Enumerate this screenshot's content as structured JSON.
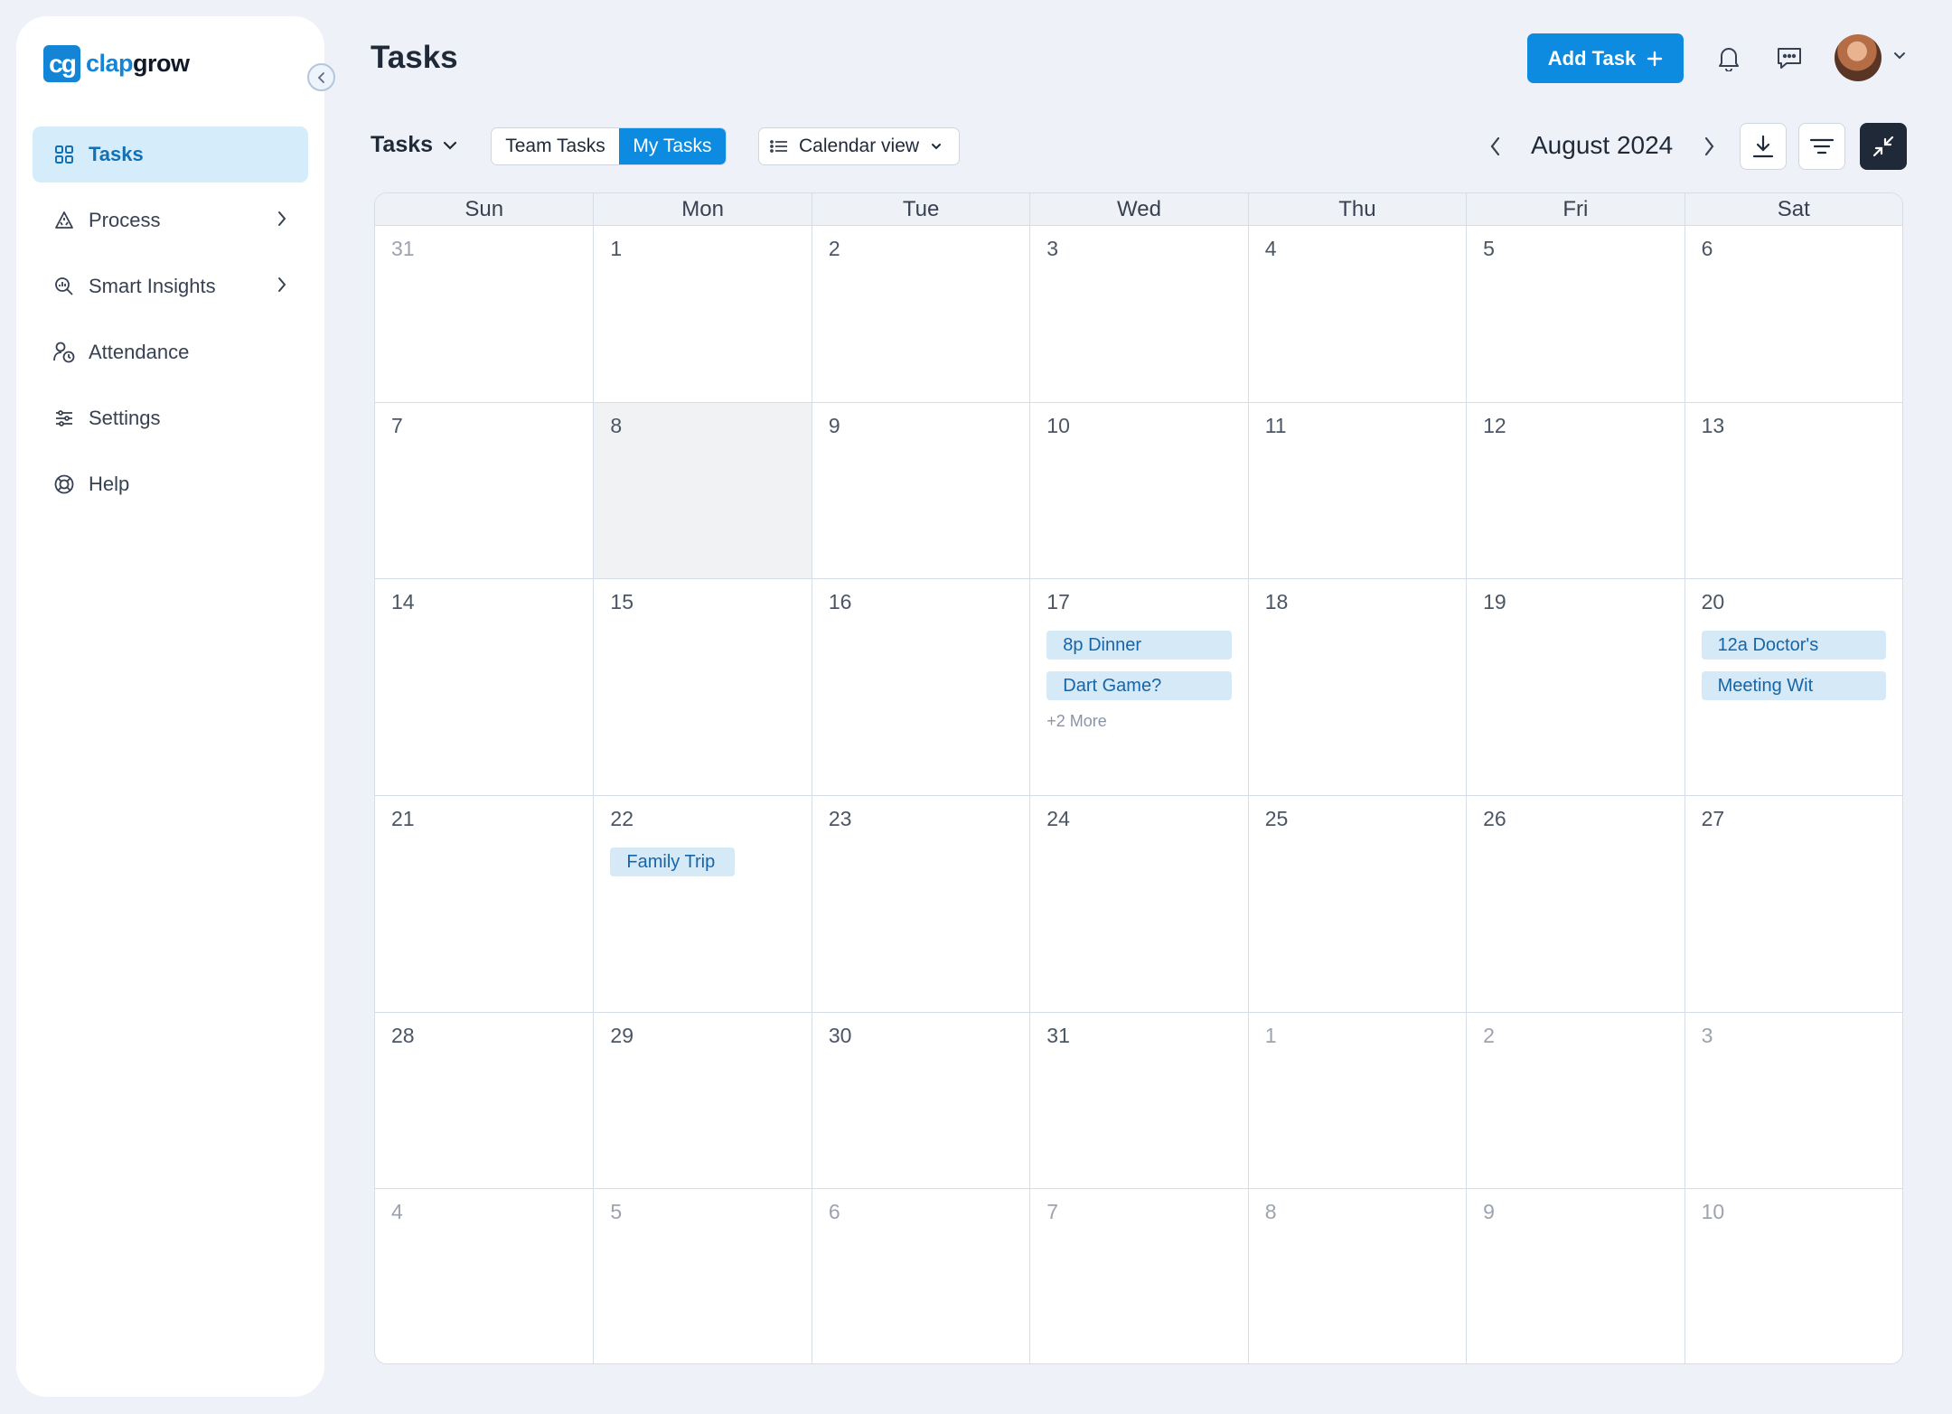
{
  "brand": {
    "mark": "cg",
    "name_part1": "clap",
    "name_part2": "grow"
  },
  "sidebar": {
    "items": [
      {
        "label": "Tasks",
        "icon": "grid-icon",
        "active": true,
        "chevron": false
      },
      {
        "label": "Process",
        "icon": "triangle-recycle-icon",
        "active": false,
        "chevron": true
      },
      {
        "label": "Smart Insights",
        "icon": "magnify-chart-icon",
        "active": false,
        "chevron": true
      },
      {
        "label": "Attendance",
        "icon": "user-clock-icon",
        "active": false,
        "chevron": false
      },
      {
        "label": "Settings",
        "icon": "sliders-icon",
        "active": false,
        "chevron": false
      },
      {
        "label": "Help",
        "icon": "lifebuoy-icon",
        "active": false,
        "chevron": false
      }
    ]
  },
  "header": {
    "title": "Tasks",
    "add_task_label": "Add Task"
  },
  "toolbar": {
    "tasks_dropdown": "Tasks",
    "team_tasks": "Team Tasks",
    "my_tasks": "My Tasks",
    "view_dropdown": "Calendar view",
    "month": "August 2024"
  },
  "calendar": {
    "weekdays": [
      "Sun",
      "Mon",
      "Tue",
      "Wed",
      "Thu",
      "Fri",
      "Sat"
    ],
    "weeks": [
      [
        {
          "n": "31",
          "m": true
        },
        {
          "n": "1"
        },
        {
          "n": "2"
        },
        {
          "n": "3"
        },
        {
          "n": "4"
        },
        {
          "n": "5"
        },
        {
          "n": "6"
        }
      ],
      [
        {
          "n": "7"
        },
        {
          "n": "8",
          "today": true
        },
        {
          "n": "9"
        },
        {
          "n": "10"
        },
        {
          "n": "11"
        },
        {
          "n": "12"
        },
        {
          "n": "13"
        }
      ],
      [
        {
          "n": "14"
        },
        {
          "n": "15"
        },
        {
          "n": "16"
        },
        {
          "n": "17",
          "events": [
            "8p Dinner",
            "Dart Game?"
          ],
          "more": "+2 More"
        },
        {
          "n": "18"
        },
        {
          "n": "19"
        },
        {
          "n": "20",
          "events": [
            "12a Doctor's",
            "Meeting Wit"
          ]
        }
      ],
      [
        {
          "n": "21"
        },
        {
          "n": "22",
          "events": [
            "Family Trip"
          ],
          "short": true
        },
        {
          "n": "23"
        },
        {
          "n": "24"
        },
        {
          "n": "25"
        },
        {
          "n": "26"
        },
        {
          "n": "27"
        }
      ],
      [
        {
          "n": "28"
        },
        {
          "n": "29"
        },
        {
          "n": "30"
        },
        {
          "n": "31"
        },
        {
          "n": "1",
          "m": true
        },
        {
          "n": "2",
          "m": true
        },
        {
          "n": "3",
          "m": true
        }
      ],
      [
        {
          "n": "4",
          "m": true
        },
        {
          "n": "5",
          "m": true
        },
        {
          "n": "6",
          "m": true
        },
        {
          "n": "7",
          "m": true
        },
        {
          "n": "8",
          "m": true
        },
        {
          "n": "9",
          "m": true
        },
        {
          "n": "10",
          "m": true
        }
      ]
    ]
  },
  "colors": {
    "accent": "#0d8be0",
    "event_bg": "#d5e9f7",
    "event_text": "#1765a6",
    "page_bg": "#eef2f8"
  }
}
